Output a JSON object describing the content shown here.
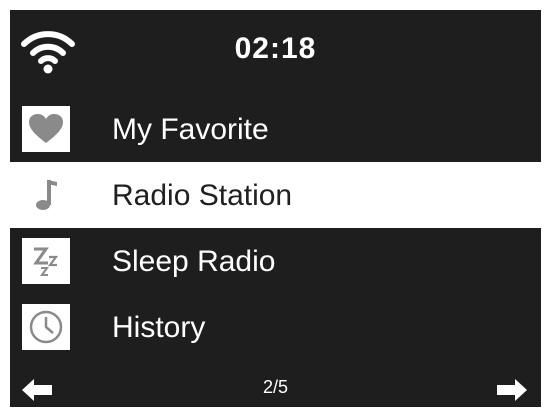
{
  "status": {
    "time": "02:18",
    "wifi_icon": "wifi-icon"
  },
  "menu": {
    "items": [
      {
        "label": "My Favorite",
        "icon": "heart-icon",
        "selected": false
      },
      {
        "label": "Radio Station",
        "icon": "music-note-icon",
        "selected": true
      },
      {
        "label": "Sleep Radio",
        "icon": "sleep-zzz-icon",
        "selected": false
      },
      {
        "label": "History",
        "icon": "clock-icon",
        "selected": false
      }
    ]
  },
  "footer": {
    "page": "2/5",
    "left_icon": "arrow-left-icon",
    "right_icon": "arrow-right-icon"
  },
  "colors": {
    "background": "#1e1e1e",
    "selected_background": "#ffffff",
    "text": "#ffffff",
    "selected_text": "#202020",
    "icon_gray": "#8a8a8a"
  }
}
